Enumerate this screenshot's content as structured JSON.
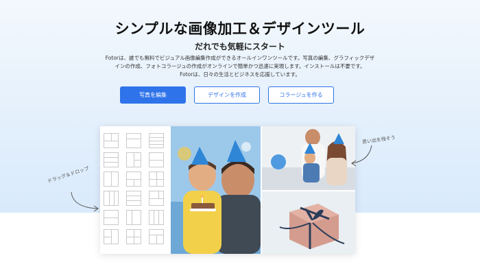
{
  "hero": {
    "headline": "シンプルな画像加工＆デザインツール",
    "subheadline": "だれでも気軽にスタート",
    "description_line1": "Fotorは、誰でも無料でビジュアル画像編集作成ができるオールインワンツールです。写真の編集、グラフィックデザ",
    "description_line2": "インの作成、フォトコラージュの作成がオンラインで簡単かつ迅速に実現します。インストールは不要です。",
    "description_line3": "Fotorは、日々の生活とビジネスを応援しています。"
  },
  "buttons": {
    "edit_photo": "写真を編集",
    "create_design": "デザインを作成",
    "create_collage": "コラージュを作る"
  },
  "annotations": {
    "drag_drop": "ドラッグ＆ドロップ",
    "memories": "思い出を残そう"
  },
  "colors": {
    "accent": "#2f73ea",
    "hero_bg": "#e4f0fc"
  },
  "icons": [
    "curved-arrow-icon"
  ]
}
